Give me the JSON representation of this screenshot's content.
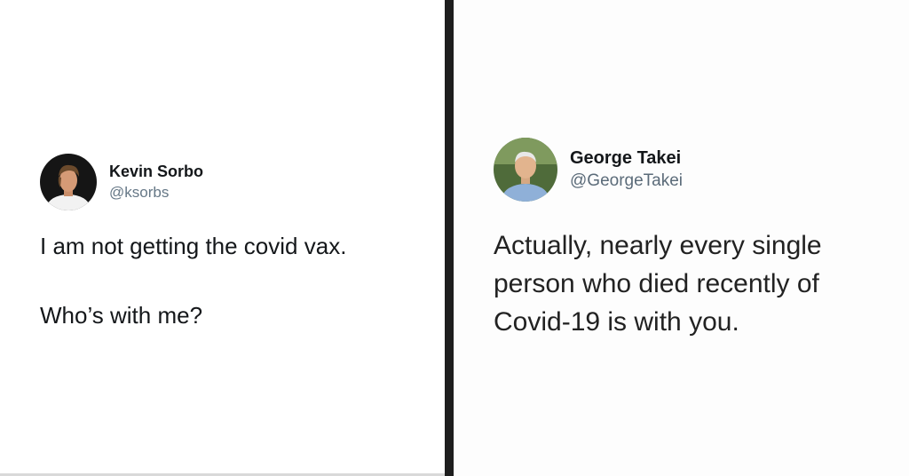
{
  "left_tweet": {
    "display_name": "Kevin Sorbo",
    "handle": "@ksorbs",
    "text_line_1": "I am not getting the covid vax.",
    "text_line_2": "Who’s with me?",
    "avatar_icon": "person-avatar-icon"
  },
  "right_tweet": {
    "display_name": "George Takei",
    "handle": "@GeorgeTakei",
    "text_lines": [
      "Actually, nearly every single",
      "person who died recently of",
      "Covid-19 is with you."
    ],
    "avatar_icon": "person-avatar-icon"
  },
  "colors": {
    "divider": "#1e1e1e",
    "name_text": "#14171a",
    "handle_text": "#657786"
  }
}
